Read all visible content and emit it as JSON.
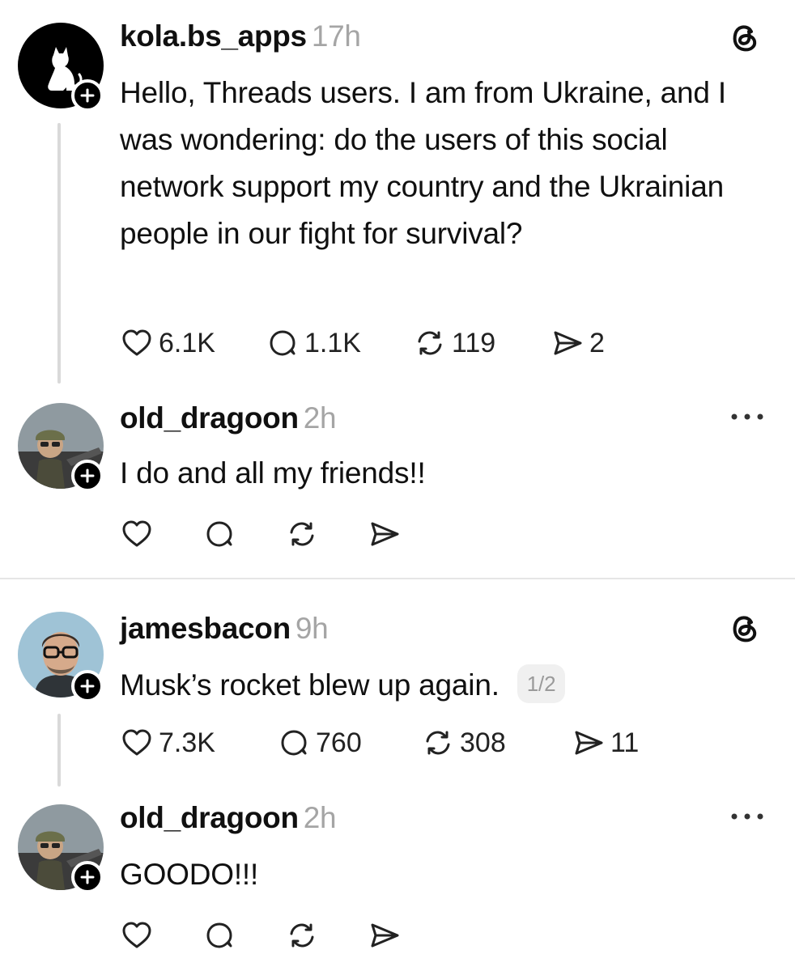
{
  "posts": [
    {
      "username": "kola.bs_apps",
      "time": "17h",
      "text": "Hello, Threads users. I am from Ukraine, and I was wondering: do the users of this social network support my country and the Ukrainian people in our fight for survival?",
      "likes": "6.1K",
      "replies": "1.1K",
      "reposts": "119",
      "shares": "2",
      "corner_icon": "threads-logo-icon"
    },
    {
      "username": "old_dragoon",
      "time": "2h",
      "text": "I do and all my friends!!",
      "corner_icon": "more-options-icon"
    },
    {
      "username": "jamesbacon",
      "time": "9h",
      "text": "Musk’s rocket blew up again.",
      "page_indicator": "1/2",
      "likes": "7.3K",
      "replies": "760",
      "reposts": "308",
      "shares": "11",
      "corner_icon": "threads-logo-icon"
    },
    {
      "username": "old_dragoon",
      "time": "2h",
      "text": "GOODO!!!",
      "corner_icon": "more-options-icon"
    }
  ]
}
